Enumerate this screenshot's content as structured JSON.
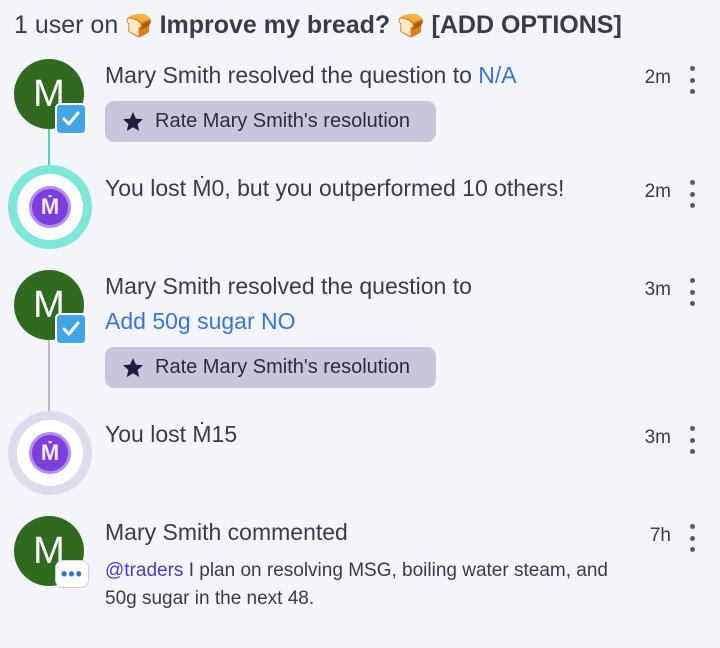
{
  "header": {
    "count": "1 user on",
    "bread_emoji": "🍞",
    "title": "Improve my bread?",
    "suffix": "[ADD OPTIONS]"
  },
  "feed": [
    {
      "type": "resolution",
      "avatar_letter": "M",
      "text": "Mary Smith resolved the question to",
      "answer": "N/A",
      "time": "2m",
      "rate_label": "Rate Mary Smith's resolution"
    },
    {
      "type": "payout",
      "prefix": "You lost ",
      "amount": "Ṁ0",
      "suffix": ", but you outperformed 10 others!",
      "time": "2m",
      "coin_symbol": "Ṁ"
    },
    {
      "type": "resolution",
      "avatar_letter": "M",
      "text": "Mary Smith resolved the question to",
      "answer": "Add 50g sugar NO",
      "time": "3m",
      "rate_label": "Rate Mary Smith's resolution"
    },
    {
      "type": "payout",
      "prefix": "You lost ",
      "amount": "Ṁ15",
      "time": "3m",
      "coin_symbol": "Ṁ"
    },
    {
      "type": "comment",
      "avatar_letter": "M",
      "text": "Mary Smith commented",
      "mention": "@traders",
      "body": " I plan on resolving MSG, boiling water steam, and 50g sugar in the next 48.",
      "time": "7h"
    }
  ],
  "colors": {
    "avatar_bg": "#2f6a1f",
    "link": "#3b74d9",
    "mention": "#4c39c7",
    "rate_button_bg": "#c7c6dc",
    "coin": "#7c3fdc",
    "ring_highlight": "#7ee8d8",
    "ring_normal": "#dcdcec"
  },
  "icons": [
    "check-badge-icon",
    "star-icon",
    "kebab-menu-icon",
    "mana-coin-icon",
    "comment-bubble-icon"
  ]
}
